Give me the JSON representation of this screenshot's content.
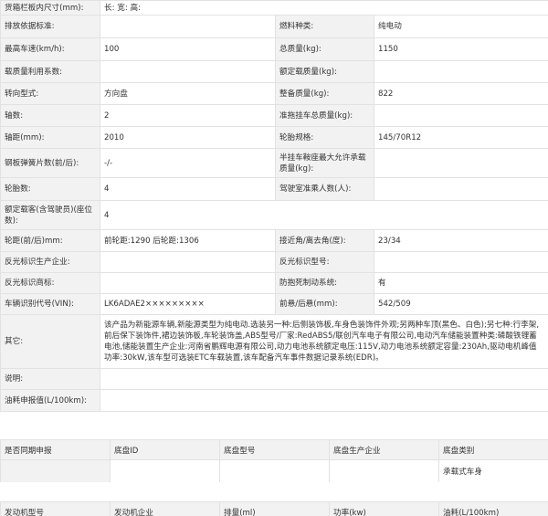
{
  "spec_rows": [
    {
      "l1": "货箱栏板内尺寸(mm):",
      "v1": "长:  宽:  高:",
      "l2": null,
      "v2": null
    },
    {
      "l1": "排放依据标准:",
      "v1": "",
      "l2": "燃料种类:",
      "v2": "纯电动"
    },
    {
      "l1": "最高车速(km/h):",
      "v1": "100",
      "l2": "总质量(kg):",
      "v2": "1150"
    },
    {
      "l1": "载质量利用系数:",
      "v1": "",
      "l2": "额定载质量(kg):",
      "v2": ""
    },
    {
      "l1": "转向型式:",
      "v1": "方向盘",
      "l2": "整备质量(kg):",
      "v2": "822"
    },
    {
      "l1": "轴数:",
      "v1": "2",
      "l2": "准拖挂车总质量(kg):",
      "v2": ""
    },
    {
      "l1": "轴距(mm):",
      "v1": "2010",
      "l2": "轮胎规格:",
      "v2": "145/70R12"
    },
    {
      "l1": "钢板弹簧片数(前/后):",
      "v1": "-/-",
      "l2": "半挂车鞍座最大允许承载质量(kg):",
      "v2": ""
    },
    {
      "l1": "轮胎数:",
      "v1": "4",
      "l2": "驾驶室准乘人数(人):",
      "v2": ""
    },
    {
      "l1": "额定载客(含驾驶员)(座位数):",
      "v1": "4",
      "l2": null,
      "v2": null
    },
    {
      "l1": "轮距(前/后)mm:",
      "v1": "前轮距:1290 后轮距:1306",
      "l2": "接近角/离去角(度):",
      "v2": "23/34"
    },
    {
      "l1": "反光标识生产企业:",
      "v1": "",
      "l2": "反光标识型号:",
      "v2": ""
    },
    {
      "l1": "反光标识商标:",
      "v1": "",
      "l2": "防抱死制动系统:",
      "v2": "有"
    },
    {
      "l1": "车辆识别代号(VIN):",
      "v1": "LK6ADAE2×××××××××",
      "l2": "前悬/后悬(mm):",
      "v2": "542/509"
    }
  ],
  "other": {
    "label": "其它:",
    "text": "该产品为新能源车辆,新能源类型为纯电动.选装另一种:后侧装饰板,车身色装饰件外观;另两种车顶(黑色、白色);另七种:行李架,前后保下装饰件,裙边装饰板,车轮装饰盖,ABS型号/厂家:RedABS5/联创汽车电子有限公司,电动汽车储能装置种类:磷酸铁锂蓄电池,储能装置生产企业:河南省鹏辉电源有限公司,动力电池系统额定电压:115V,动力电池系统额定容量:230Ah,驱动电机峰值功率:30kW,该车型可选装ETC车载装置,该车配备汽车事件数据记录系统(EDR)。"
  },
  "note": {
    "label": "说明:",
    "value": ""
  },
  "fuel": {
    "label": "油耗申报值(L/100km):",
    "value": ""
  },
  "chassis": {
    "headers": [
      "是否同期申报",
      "底盘ID",
      "底盘型号",
      "底盘生产企业",
      "底盘类别"
    ],
    "values": [
      "",
      "",
      "",
      "",
      "承载式车身"
    ]
  },
  "engine": {
    "headers": [
      "发动机型号",
      "发动机企业",
      "排量(ml)",
      "功率(kw)",
      "油耗(L/100km)"
    ]
  }
}
